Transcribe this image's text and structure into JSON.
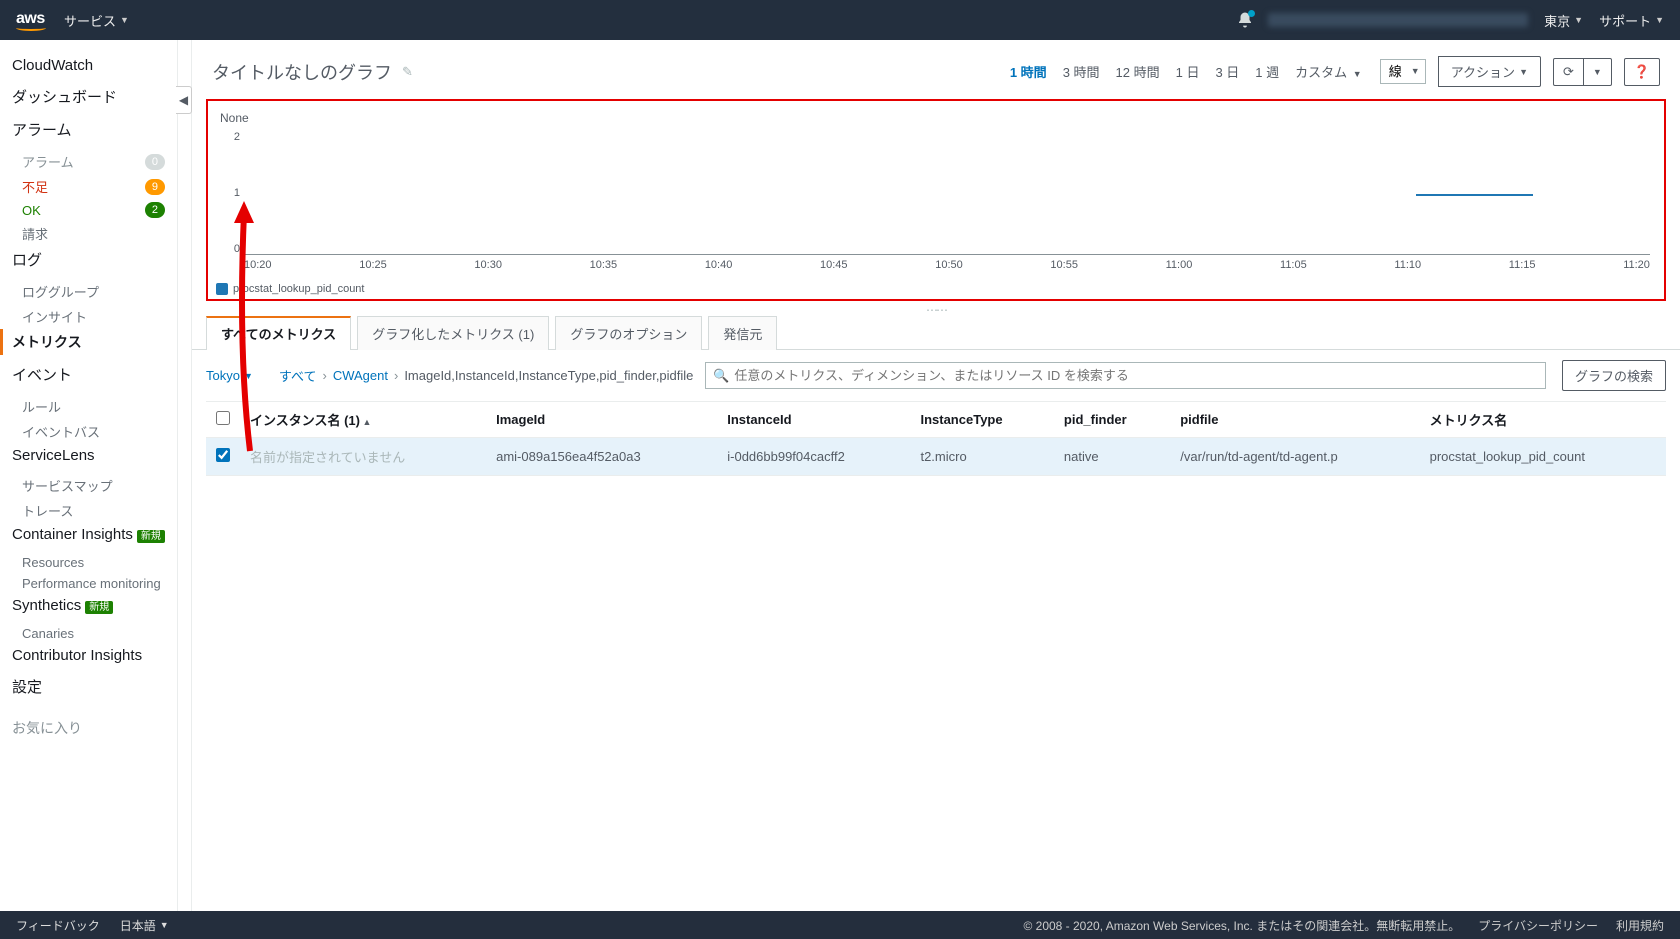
{
  "topbar": {
    "services": "サービス",
    "region": "東京",
    "support": "サポート"
  },
  "sidebar": {
    "cloudwatch": "CloudWatch",
    "dashboard": "ダッシュボード",
    "alarm": "アラーム",
    "alarm_sub": "アラーム",
    "alarm_sub_badge": "0",
    "insufficient": "不足",
    "insufficient_badge": "9",
    "ok": "OK",
    "ok_badge": "2",
    "billing": "請求",
    "log": "ログ",
    "log_group": "ロググループ",
    "insight": "インサイト",
    "metrics": "メトリクス",
    "event": "イベント",
    "rule": "ルール",
    "event_bus": "イベントバス",
    "servicelens": "ServiceLens",
    "service_map": "サービスマップ",
    "trace": "トレース",
    "container": "Container Insights",
    "new1": "新規",
    "resources": "Resources",
    "perf": "Performance monitoring",
    "synthetics": "Synthetics",
    "new2": "新規",
    "canaries": "Canaries",
    "contributor": "Contributor Insights",
    "settings": "設定",
    "favorites": "お気に入り"
  },
  "title": "タイトルなしのグラフ",
  "time": {
    "h1": "1 時間",
    "h3": "3 時間",
    "h12": "12 時間",
    "d1": "1 日",
    "d3": "3 日",
    "w1": "1 週",
    "custom": "カスタム"
  },
  "chart_type": "線",
  "actions": "アクション",
  "chart_data": {
    "type": "line",
    "title": "None",
    "ylim": [
      0,
      2
    ],
    "yticks": [
      "2",
      "1",
      "0"
    ],
    "x_categories": [
      "10:20",
      "10:25",
      "10:30",
      "10:35",
      "10:40",
      "10:45",
      "10:50",
      "10:55",
      "11:00",
      "11:05",
      "11:10",
      "11:15",
      "11:20"
    ],
    "series": [
      {
        "name": "procstat_lookup_pid_count",
        "color": "#1f77b4",
        "segment": {
          "x_start_idx": 10,
          "x_end_idx": 11,
          "value": 1
        }
      }
    ]
  },
  "tabs": {
    "all": "すべてのメトリクス",
    "graphed": "グラフ化したメトリクス (1)",
    "options": "グラフのオプション",
    "source": "発信元"
  },
  "crumbs": {
    "region": "Tokyo",
    "all": "すべて",
    "ns": "CWAgent",
    "dims": "ImageId,InstanceId,InstanceType,pid_finder,pidfile"
  },
  "search_placeholder": "任意のメトリクス、ディメンション、またはリソース ID を検索する",
  "graph_search": "グラフの検索",
  "cols": {
    "instance_name": "インスタンス名 (1)",
    "image_id": "ImageId",
    "instance_id": "InstanceId",
    "instance_type": "InstanceType",
    "pid_finder": "pid_finder",
    "pidfile": "pidfile",
    "metric": "メトリクス名"
  },
  "row": {
    "instance_name": "名前が指定されていません",
    "image_id": "ami-089a156ea4f52a0a3",
    "instance_id": "i-0dd6bb99f04cacff2",
    "instance_type": "t2.micro",
    "pid_finder": "native",
    "pidfile": "/var/run/td-agent/td-agent.p",
    "metric": "procstat_lookup_pid_count"
  },
  "footer": {
    "feedback": "フィードバック",
    "lang": "日本語",
    "copyright": "© 2008 - 2020, Amazon Web Services, Inc. またはその関連会社。無断転用禁止。",
    "privacy": "プライバシーポリシー",
    "terms": "利用規約"
  }
}
